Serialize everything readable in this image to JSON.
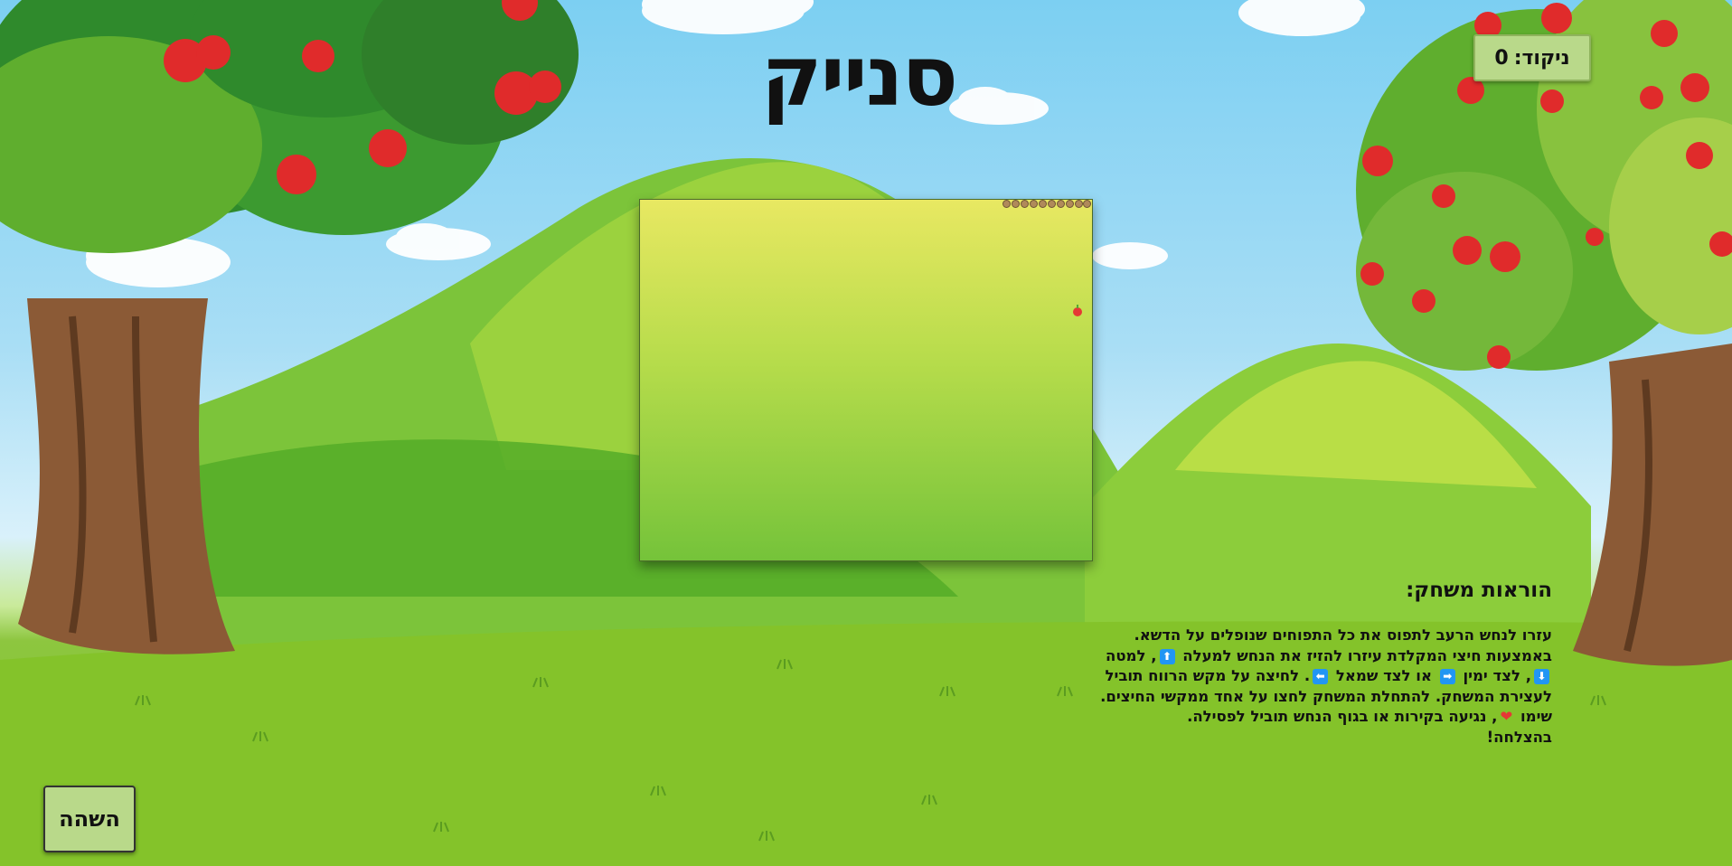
{
  "game": {
    "title": "סנייק",
    "score_label": "ניקוד:",
    "score_value": "0",
    "pause_label": "השהה"
  },
  "instructions": {
    "heading": "הוראות משחק:",
    "p1": "עזרו לנחש הרעב לתפוס את כל התפוחים שנופלים על הדשא. באמצעות חיצי המקלדת עיזרו להזיז את הנחש למעלה",
    "p2": ", למטה",
    "p3": ", לצד ימין",
    "p4": "או לצד שמאל",
    "p5": ". לחיצה על מקש הרווח תוביל לעצירת המשחק. להתחלת המשחק לחצו על אחד ממקשי החיצים.",
    "p6": "שימו",
    "p7": ", נגיעה בקירות או בגוף הנחש תוביל לפסילה.",
    "p8": "בהצלחה!",
    "icons": [
      "arrow-up-icon",
      "arrow-down-icon",
      "arrow-right-icon",
      "arrow-left-icon",
      "heart-icon"
    ]
  },
  "colors": {
    "score_bg": "#b9d98a",
    "snake": "#b08a5a",
    "apple": "#e53935",
    "key_blue": "#2196f3"
  }
}
